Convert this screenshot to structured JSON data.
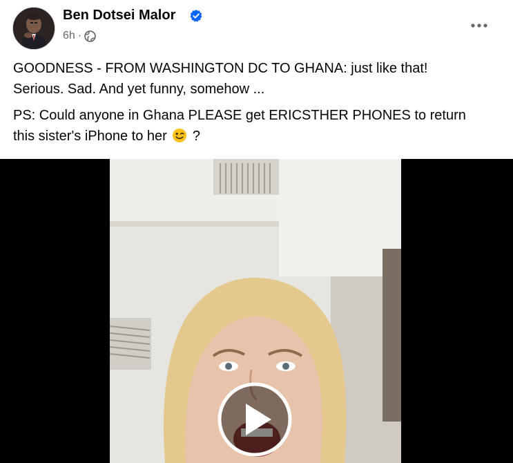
{
  "post": {
    "author_name": "Ben Dotsei Malor",
    "time": "6h",
    "separator": "·",
    "audience_icon": "globe-icon",
    "verified_icon": "verified-badge-icon",
    "more_icon": "more-options-icon",
    "paragraphs": [
      {
        "lines": [
          "GOODNESS - FROM WASHINGTON DC TO GHANA: just like that!",
          "Serious.  Sad. And yet funny, somehow ..."
        ]
      },
      {
        "lines": [
          "PS: Could anyone in Ghana PLEASE get ERICSTHER PHONES to return",
          "this sister's iPhone to her"
        ],
        "emoji": "winking-face-emoji",
        "after_emoji": " ?"
      }
    ]
  },
  "video": {
    "play_icon": "play-icon"
  },
  "colors": {
    "brand_blue": "#0866ff",
    "text_primary": "#050505",
    "text_secondary": "#65676b"
  }
}
